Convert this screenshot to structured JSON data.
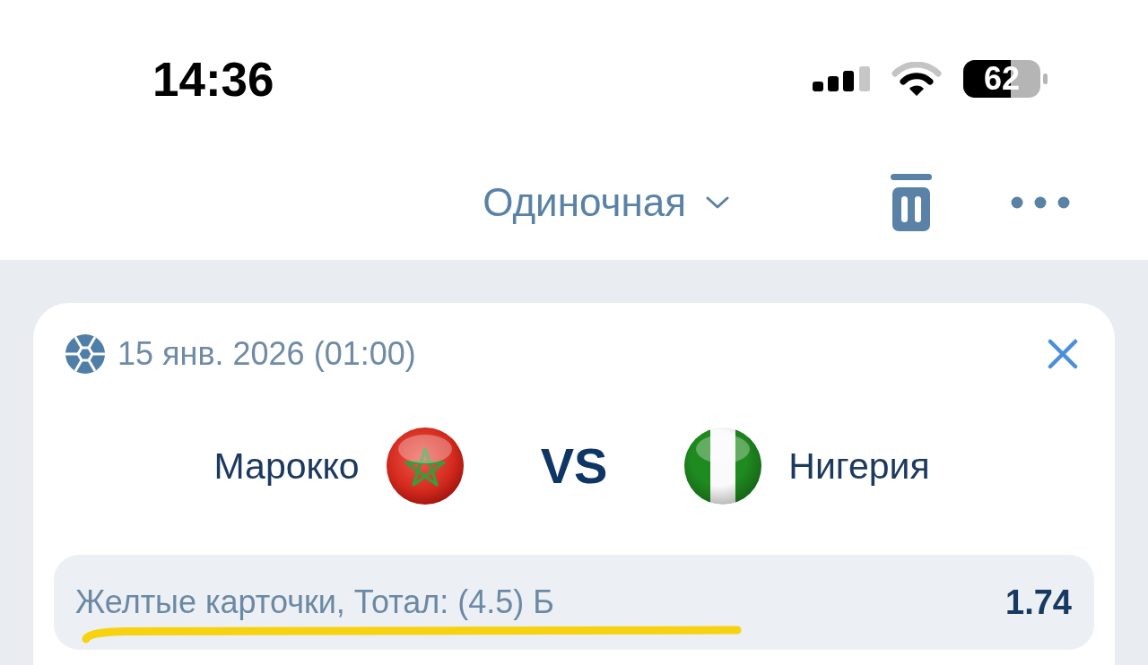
{
  "status_bar": {
    "time": "14:36",
    "battery": "62"
  },
  "header": {
    "bet_type": "Одиночная"
  },
  "bet_card": {
    "date": "15 янв. 2026 (01:00)",
    "home_team": "Марокко",
    "separator": "VS",
    "away_team": "Нигерия",
    "outcome": "Желтые карточки, Тотал: (4.5) Б",
    "odds": "1.74"
  }
}
